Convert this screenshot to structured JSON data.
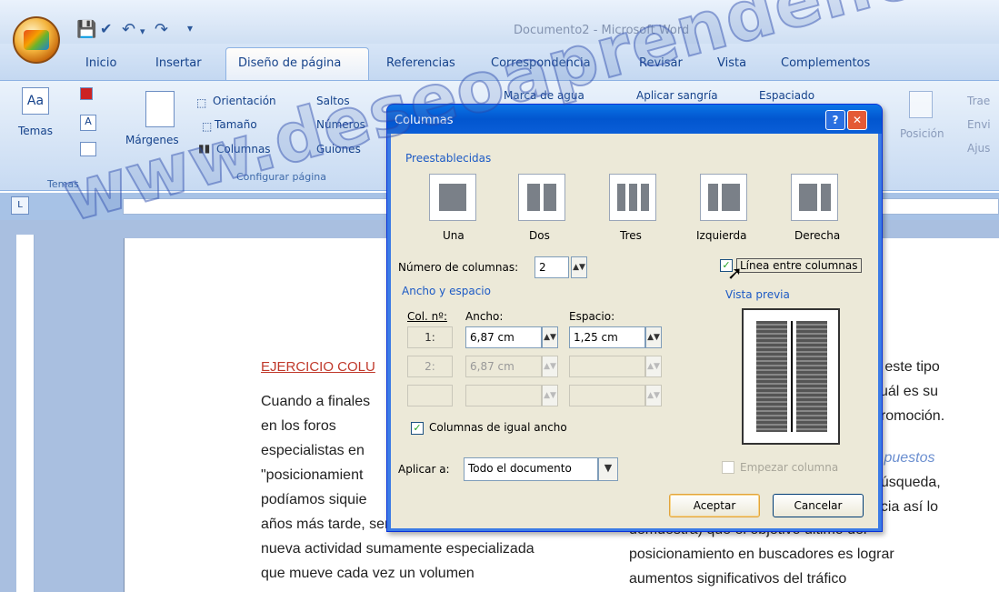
{
  "window": {
    "title": "Documento2 - Microsoft Word"
  },
  "tabs": [
    "Inicio",
    "Insertar",
    "Diseño de página",
    "Referencias",
    "Correspondencia",
    "Revisar",
    "Vista",
    "Complementos"
  ],
  "ribbon": {
    "temas": {
      "label": "Temas",
      "group": "Temas"
    },
    "margenes": "Márgenes",
    "orientacion": "Orientación",
    "tamano": "Tamaño",
    "columnas": "Columnas",
    "saltos": "Saltos",
    "numeros": "Números",
    "guiones": "Guiones",
    "config_group": "Configurar página",
    "marca_agua": "Marca de agua",
    "aplicar_sangria": "Aplicar sangría",
    "espaciado": "Espaciado",
    "posicion": "Posición",
    "traer": "Trae",
    "enviar": "Envi",
    "ajustar": "Ajus"
  },
  "dialog": {
    "title": "Columnas",
    "help_glyph": "?",
    "close_glyph": "✕",
    "presets_label": "Preestablecidas",
    "presets": [
      "Una",
      "Dos",
      "Tres",
      "Izquierda",
      "Derecha"
    ],
    "num_columns_label": "Número de columnas:",
    "num_columns_value": "2",
    "line_between_label": "Línea entre columnas",
    "line_between_checked": true,
    "width_spacing_label": "Ancho y espacio",
    "preview_label": "Vista previa",
    "headers": {
      "col": "Col. nº:",
      "width": "Ancho:",
      "spacing": "Espacio:"
    },
    "rows": [
      {
        "col": "1:",
        "width": "6,87 cm",
        "spacing": "1,25 cm"
      },
      {
        "col": "2:",
        "width": "6,87 cm",
        "spacing": ""
      },
      {
        "col": "",
        "width": "",
        "spacing": ""
      }
    ],
    "equal_width_label": "Columnas de igual ancho",
    "equal_width_checked": true,
    "apply_to_label": "Aplicar a:",
    "apply_to_value": "Todo el documento",
    "start_column_label": "Empezar columna",
    "ok_label": "Aceptar",
    "cancel_label": "Cancelar"
  },
  "document": {
    "heading": "EJERCICIO COLU",
    "left_lines": [
      "Cuando a finales",
      "en    los    foros",
      "especialistas en",
      "\"posicionamient",
      "podíamos siquie",
      "años más tarde, sería el origen de una",
      "nueva actividad sumamente especializada",
      "que    mueve    cada   vez   un   volumen"
    ],
    "right_lines": [
      "e este tipo",
      "cuál es su",
      "promoción.",
      "s puestos",
      "búsqueda,",
      "ncia así lo",
      "demuestra) que el objetivo último del",
      "posicionamiento en buscadores es lograr",
      "aumentos     significativos     del     tráfico"
    ]
  },
  "watermark": "www.deseoaprender.com"
}
